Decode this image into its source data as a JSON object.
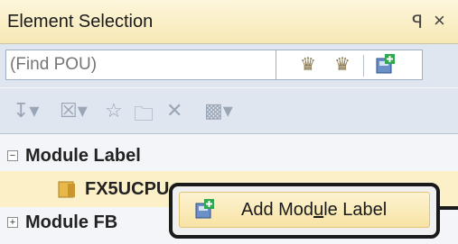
{
  "window": {
    "title": "Element Selection",
    "pin_glyph": "ꟼ",
    "close_glyph": "×"
  },
  "search": {
    "placeholder": "(Find POU)"
  },
  "search_tools": [
    {
      "icon": "find-previous-icon"
    },
    {
      "icon": "find-next-icon"
    },
    {
      "icon": "add-module-icon"
    }
  ],
  "toolbar_icons": [
    "expand-dropdown-icon",
    "delete-dropdown-icon",
    "favorite-icon",
    "folder-icon",
    "delete-icon",
    "display-dropdown-icon"
  ],
  "tree": {
    "items": [
      {
        "label": "Module Label",
        "expanded": true
      },
      {
        "label": "FX5UCPU",
        "selected": true
      },
      {
        "label": "Module FB",
        "expanded": false
      }
    ]
  },
  "context_menu": {
    "item": {
      "label_prefix": "Add Mod",
      "label_accel": "u",
      "label_suffix": "le Label"
    }
  },
  "colors": {
    "title_bg": "#f7e8b4",
    "highlight": "#fbf0c8",
    "toolbar_bg": "#dfe6ef"
  }
}
